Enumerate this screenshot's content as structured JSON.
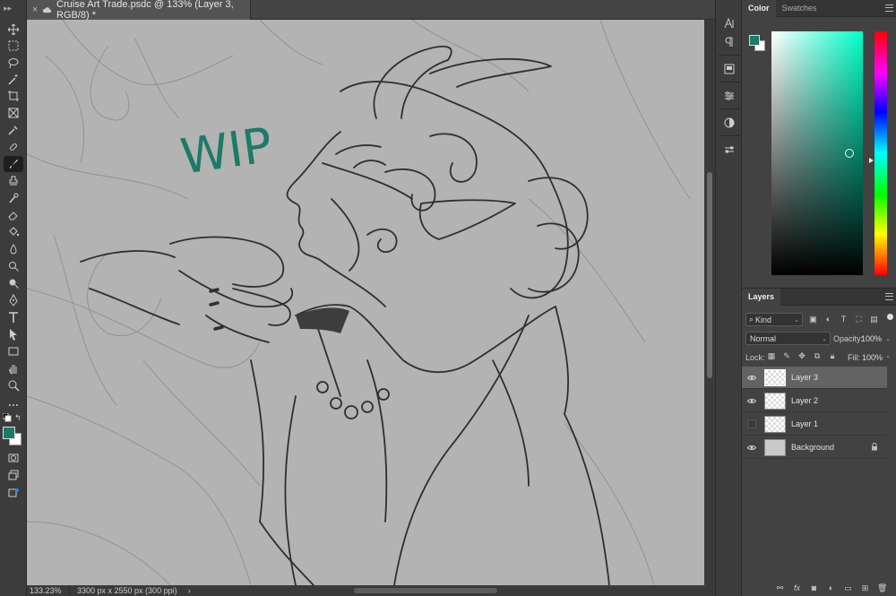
{
  "document_tab": {
    "title": "Cruise Art Trade.psdc @ 133% (Layer 3, RGB/8) *",
    "close_label": "×"
  },
  "canvas_text": {
    "wip": "WIP"
  },
  "status_bar": {
    "zoom": "133.23%",
    "dimensions": "3300 px x 2550 px (300 ppi)",
    "arrow": "›"
  },
  "color_panel": {
    "tabs": [
      "Color",
      "Swatches"
    ],
    "foreground": "#1c7a68",
    "background": "#ffffff"
  },
  "layers_panel": {
    "title": "Layers",
    "kind_filter": "Kind",
    "blend_mode": "Normal",
    "opacity_label": "Opacity:",
    "opacity_value": "100%",
    "lock_label": "Lock:",
    "fill_label": "Fill:",
    "fill_value": "100%",
    "layers": [
      {
        "name": "Layer 3",
        "visible": true,
        "selected": true
      },
      {
        "name": "Layer 2",
        "visible": true,
        "selected": false
      },
      {
        "name": "Layer 1",
        "visible": false,
        "selected": false
      },
      {
        "name": "Background",
        "visible": true,
        "selected": false,
        "locked": true
      }
    ],
    "footer_fx": "fx"
  },
  "colors": {
    "accent_teal": "#1c7a68",
    "canvas_gray": "#b3b3b3",
    "panel_bg": "#424242",
    "toolbar_bg": "#3c3c3c"
  },
  "icons": {
    "toolbar": [
      "move-icon",
      "marquee-icon",
      "lasso-icon",
      "magic-wand-icon",
      "crop-icon",
      "frame-icon",
      "eyedropper-icon",
      "healing-icon",
      "brush-icon",
      "stamp-icon",
      "history-brush-icon",
      "eraser-icon",
      "bucket-icon",
      "blur-icon",
      "dodge-icon",
      "pen-icon",
      "type-icon",
      "path-select-icon",
      "rectangle-icon",
      "hand-icon",
      "zoom-icon",
      "more-icon"
    ],
    "strip": [
      "character-icon",
      "paragraph-icon",
      "libraries-icon",
      "adjustments-icon",
      "styles-icon",
      "properties-icon"
    ]
  }
}
